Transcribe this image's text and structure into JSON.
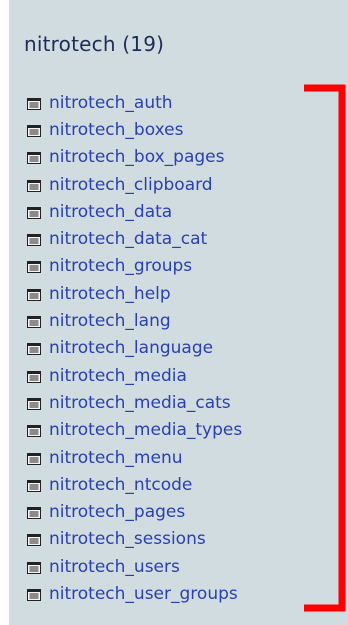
{
  "database": {
    "title": "nitrotech (19)"
  },
  "tables": [
    {
      "name": "nitrotech_auth"
    },
    {
      "name": "nitrotech_boxes"
    },
    {
      "name": "nitrotech_box_pages"
    },
    {
      "name": "nitrotech_clipboard"
    },
    {
      "name": "nitrotech_data"
    },
    {
      "name": "nitrotech_data_cat"
    },
    {
      "name": "nitrotech_groups"
    },
    {
      "name": "nitrotech_help"
    },
    {
      "name": "nitrotech_lang"
    },
    {
      "name": "nitrotech_language"
    },
    {
      "name": "nitrotech_media"
    },
    {
      "name": "nitrotech_media_cats"
    },
    {
      "name": "nitrotech_media_types"
    },
    {
      "name": "nitrotech_menu"
    },
    {
      "name": "nitrotech_ntcode"
    },
    {
      "name": "nitrotech_pages"
    },
    {
      "name": "nitrotech_sessions"
    },
    {
      "name": "nitrotech_users"
    },
    {
      "name": "nitrotech_user_groups"
    }
  ],
  "icons": {
    "table": "table-icon"
  },
  "colors": {
    "panel_bg": "#d0dce0",
    "title": "#1e2d57",
    "link": "#2a3fb0",
    "bracket": "#ff0000"
  }
}
